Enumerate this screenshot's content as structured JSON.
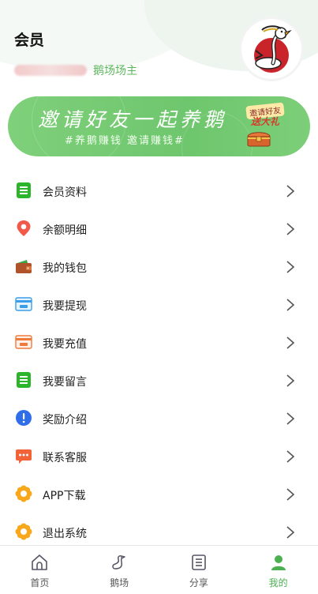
{
  "header": {
    "title": "会员",
    "role": "鹅场场主"
  },
  "banner": {
    "title": "邀请好友一起养鹅",
    "subtitle": "#养鹅赚钱 邀请赚钱#",
    "badge_top": "邀请好友",
    "badge_bottom": "送大礼"
  },
  "menu": {
    "items": [
      {
        "label": "会员资料",
        "icon": "document-list-icon"
      },
      {
        "label": "余额明细",
        "icon": "location-pin-icon"
      },
      {
        "label": "我的钱包",
        "icon": "wallet-icon"
      },
      {
        "label": "我要提现",
        "icon": "withdraw-card-icon"
      },
      {
        "label": "我要充值",
        "icon": "recharge-card-icon"
      },
      {
        "label": "我要留言",
        "icon": "message-list-icon"
      },
      {
        "label": "奖励介绍",
        "icon": "info-alert-icon"
      },
      {
        "label": "联系客服",
        "icon": "chat-bubble-icon"
      },
      {
        "label": "APP下载",
        "icon": "flower-download-icon"
      },
      {
        "label": "退出系统",
        "icon": "flower-logout-icon"
      }
    ]
  },
  "tabbar": {
    "tabs": [
      {
        "label": "首页",
        "icon": "home-icon"
      },
      {
        "label": "鹅场",
        "icon": "goose-icon"
      },
      {
        "label": "分享",
        "icon": "share-list-icon"
      },
      {
        "label": "我的",
        "icon": "user-icon"
      }
    ],
    "active": "我的"
  },
  "colors": {
    "accent": "#5cb85c",
    "banner": "#72c86e",
    "active_tab": "#4caf50"
  }
}
